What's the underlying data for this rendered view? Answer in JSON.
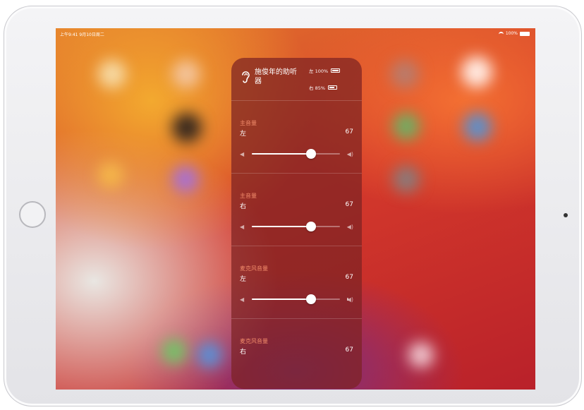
{
  "status_bar": {
    "time_date": "上午9:41  9月10日周二",
    "battery": "100%"
  },
  "hearing_panel": {
    "device_name": "施俊年的助听器",
    "left_battery_label": "左 100%",
    "left_battery_level": 1.0,
    "right_battery_label": "右 85%",
    "right_battery_level": 0.85,
    "sections": [
      {
        "title": "主音量",
        "side": "左",
        "value": "67",
        "level": 0.67
      },
      {
        "title": "主音量",
        "side": "右",
        "value": "67",
        "level": 0.67
      },
      {
        "title": "麦克风音量",
        "side": "左",
        "value": "67",
        "level": 0.67
      },
      {
        "title": "麦克风音量",
        "side": "右",
        "value": "67",
        "level": 0.67
      }
    ]
  },
  "colors": {
    "section_title": "#f08a6a",
    "panel_bg": "#7d2323"
  },
  "icons": {
    "ear": "ear-icon",
    "speaker_low": "speaker-low-icon",
    "speaker_high": "speaker-high-icon"
  }
}
